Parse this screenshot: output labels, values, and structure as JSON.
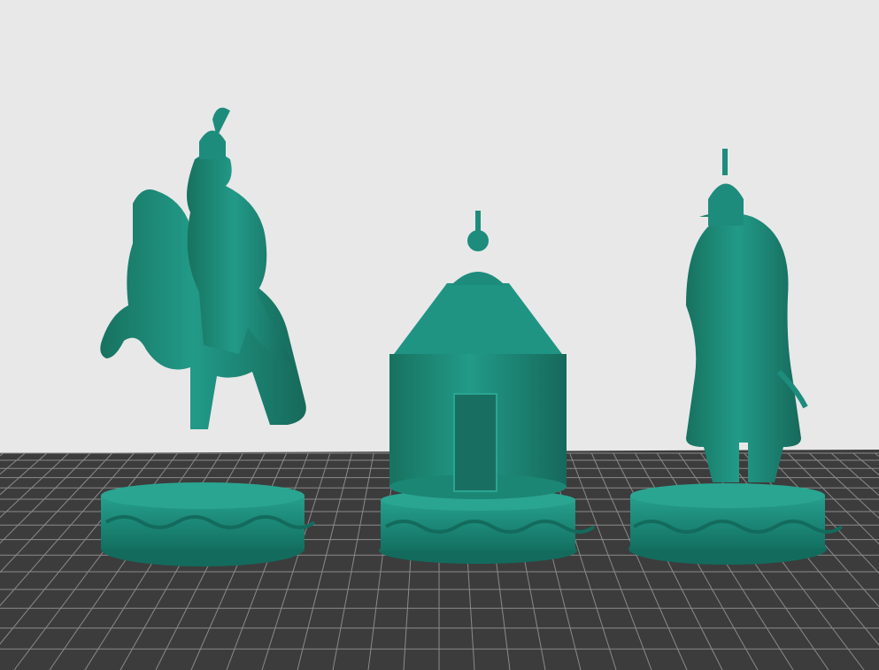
{
  "viewport": {
    "background": "#e8e8e8",
    "bed_color": "#3c3c3c",
    "grid_line_color": "#8a8a8a"
  },
  "models": [
    {
      "name": "mounted-warrior-knight",
      "color": "#1e8c7c"
    },
    {
      "name": "yurt-tower-rook",
      "color": "#1e8c7c"
    },
    {
      "name": "standing-warrior-pawn",
      "color": "#1e8c7c"
    }
  ]
}
